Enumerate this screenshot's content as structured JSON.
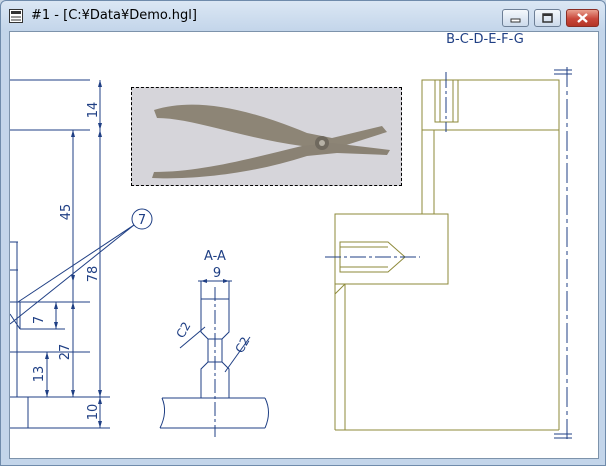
{
  "window": {
    "title": "#1 - [C:¥Data¥Demo.hgl]",
    "icons": {
      "app": "document-app-icon",
      "minimize": "minimize-icon",
      "maximize": "maximize-icon",
      "close": "close-icon"
    }
  },
  "drawing": {
    "section_header": "B-C-D-E-F-G",
    "dimensions": [
      "14",
      "45",
      "78",
      "7",
      "27",
      "13",
      "10"
    ],
    "balloon": "7",
    "section_label": "A-A",
    "width_dim": "9",
    "chamfer_left": "C2",
    "chamfer_right": "C2"
  },
  "colors": {
    "dimension_lines": "#1f3f84",
    "part_outline": "#8e8a3a",
    "photo_frame": "#000000"
  }
}
